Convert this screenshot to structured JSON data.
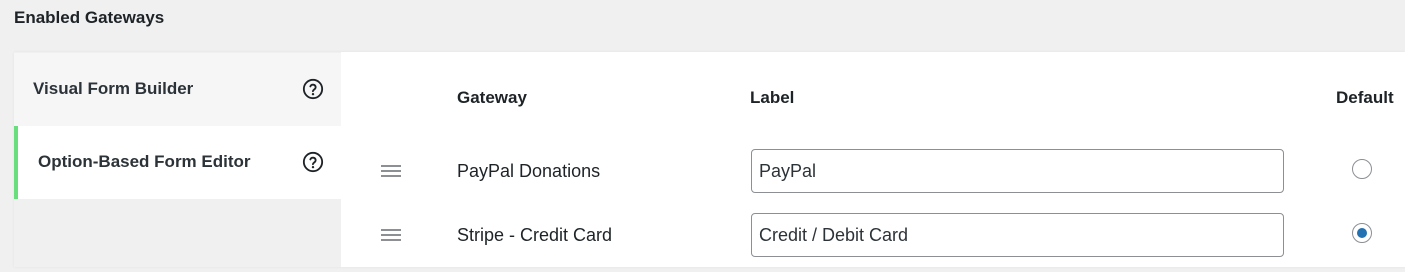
{
  "page": {
    "heading": "Enabled Gateways"
  },
  "sidebar": {
    "items": [
      {
        "label": "Visual Form Builder",
        "icon": "help-circle-icon",
        "active": false
      },
      {
        "label": "Option-Based Form Editor",
        "icon": "help-circle-icon",
        "active": true
      }
    ],
    "active_accent_color": "#68de7c"
  },
  "table": {
    "headers": {
      "gateway": "Gateway",
      "label": "Label",
      "default": "Default"
    },
    "rows": [
      {
        "gateway": "PayPal Donations",
        "label_value": "PayPal",
        "default": false
      },
      {
        "gateway": "Stripe - Credit Card",
        "label_value": "Credit / Debit Card",
        "default": true
      }
    ]
  },
  "colors": {
    "radio_checked": "#2271b1"
  }
}
